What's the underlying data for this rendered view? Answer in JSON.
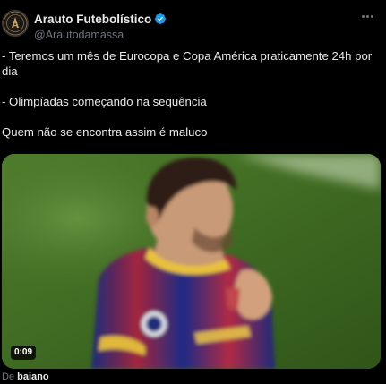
{
  "author": {
    "display_name": "Arauto Futebolístico",
    "handle": "@Arautodamassa",
    "verified": true,
    "verified_color": "#1d9bf0"
  },
  "tweet": {
    "lines": [
      "- Teremos um mês de Eurocopa e Copa América praticamente 24h por dia",
      "- Olimpíadas começando na sequência",
      "Quem não se encontra assim é maluco"
    ]
  },
  "media": {
    "type": "video",
    "duration": "0:09",
    "source_prefix": "De",
    "source_user": "baiano"
  },
  "icons": {
    "more": "more-horizontal-icon",
    "verified": "verified-badge-icon"
  },
  "colors": {
    "background": "#000000",
    "text": "#e7e9ea",
    "secondary_text": "#71767b",
    "accent": "#1d9bf0"
  }
}
